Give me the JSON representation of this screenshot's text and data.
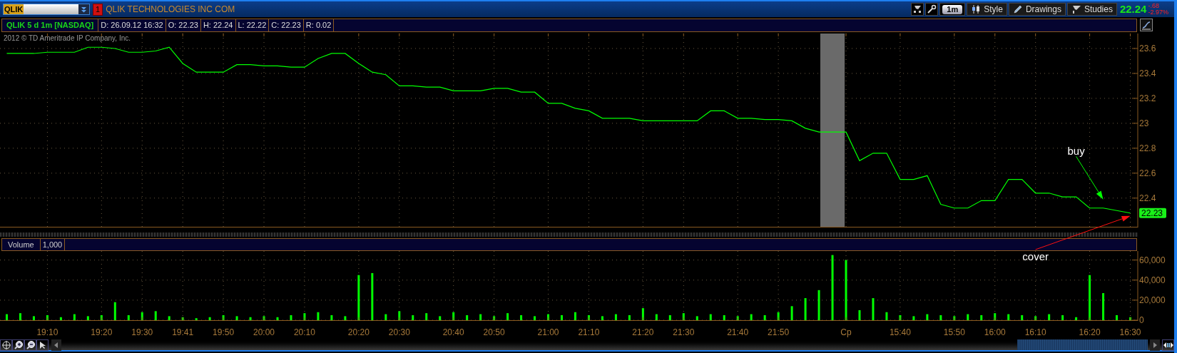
{
  "toolbar": {
    "symbol": "QLIK",
    "alert_count": "1",
    "company": "QLIK TECHNOLOGIES INC COM",
    "aggregation": "1m",
    "buttons": [
      "Style",
      "Drawings",
      "Studies"
    ],
    "last_price": "22.24",
    "change": "-.68",
    "change_percent": "-2.97%"
  },
  "info_bar": {
    "title": "QLIK 5 d 1m [NASDAQ]",
    "fields": [
      "D: 26.09.12 16:32",
      "O: 22.23",
      "H: 22.24",
      "L: 22.22",
      "C: 22.23",
      "R: 0.02"
    ]
  },
  "price_panel": {
    "copyright": "2012 © TD Ameritrade IP Company, Inc.",
    "last_price_label": "22.23",
    "chart_data": {
      "type": "line",
      "grid": true,
      "categories": [
        null,
        null,
        null,
        null,
        null,
        null,
        null,
        null,
        null,
        null,
        null,
        null,
        null,
        null,
        null,
        null,
        null,
        null,
        null,
        null,
        null,
        null,
        null,
        null,
        null,
        null,
        null,
        null,
        null,
        null,
        null,
        null,
        null,
        null,
        null,
        null,
        null,
        null,
        null,
        null,
        null,
        null,
        null,
        null,
        null,
        null,
        null,
        null,
        null,
        null,
        null,
        null,
        null,
        null,
        null,
        null,
        null,
        null,
        null,
        null,
        null,
        null,
        null,
        null,
        null,
        null,
        null,
        null,
        null,
        null,
        null,
        null,
        null,
        null,
        null,
        null,
        null,
        null,
        null,
        null,
        null,
        null,
        null,
        null
      ],
      "values": [
        23.56,
        23.56,
        23.56,
        23.57,
        23.57,
        23.57,
        23.61,
        23.61,
        23.6,
        23.57,
        23.57,
        23.58,
        23.61,
        23.48,
        23.41,
        23.41,
        23.41,
        23.47,
        23.47,
        23.46,
        23.46,
        23.45,
        23.45,
        23.52,
        23.56,
        23.56,
        23.48,
        23.41,
        23.39,
        23.3,
        23.3,
        23.29,
        23.29,
        23.26,
        23.26,
        23.26,
        23.28,
        23.28,
        23.25,
        23.25,
        23.16,
        23.16,
        23.12,
        23.1,
        23.04,
        23.04,
        23.04,
        23.02,
        23.02,
        23.02,
        23.02,
        23.02,
        23.1,
        23.1,
        23.04,
        23.04,
        23.03,
        23.03,
        23.02,
        22.96,
        22.93,
        22.93,
        22.93,
        22.7,
        22.76,
        22.76,
        22.55,
        22.55,
        22.58,
        22.35,
        22.32,
        22.32,
        22.38,
        22.38,
        22.55,
        22.55,
        22.44,
        22.44,
        22.41,
        22.41,
        22.32,
        22.32,
        22.3,
        22.28
      ],
      "ylim": [
        22.17,
        23.72
      ],
      "yticks": [
        22.4,
        22.6,
        22.8,
        23,
        23.2,
        23.4,
        23.6
      ],
      "annotations": [
        "buy",
        "cover"
      ]
    }
  },
  "volume_panel": {
    "header": [
      "Volume",
      "1,000"
    ],
    "chart_data": {
      "type": "bar",
      "grid": true,
      "categories": [
        null,
        null,
        null,
        "19:10",
        null,
        null,
        null,
        "19:20",
        null,
        null,
        "19:30",
        null,
        null,
        "19:41",
        null,
        null,
        "19:50",
        null,
        null,
        "20:00",
        null,
        null,
        "20:10",
        null,
        null,
        null,
        "20:20",
        null,
        null,
        "20:30",
        null,
        null,
        null,
        "20:40",
        null,
        null,
        "20:50",
        null,
        null,
        null,
        "21:00",
        null,
        null,
        "21:10",
        null,
        null,
        null,
        "21:20",
        null,
        null,
        "21:30",
        null,
        null,
        null,
        "21:40",
        null,
        null,
        "21:50",
        null,
        null,
        null,
        null,
        "Cp",
        null,
        null,
        null,
        "15:40",
        null,
        null,
        null,
        "15:50",
        null,
        null,
        "16:00",
        null,
        null,
        "16:10",
        null,
        null,
        null,
        "16:20",
        null,
        null,
        "16:30"
      ],
      "values": [
        6000,
        7000,
        4000,
        5000,
        3000,
        6000,
        4000,
        5000,
        18000,
        5000,
        8000,
        9000,
        4000,
        3000,
        2000,
        3000,
        5000,
        4000,
        3000,
        4000,
        3000,
        5000,
        7000,
        8000,
        5000,
        4000,
        45000,
        47000,
        6000,
        9000,
        5000,
        7000,
        4000,
        8000,
        5000,
        6000,
        4000,
        7000,
        5000,
        4000,
        6000,
        5000,
        8000,
        5000,
        4000,
        6000,
        5000,
        12000,
        6000,
        5000,
        7000,
        4000,
        6000,
        5000,
        4000,
        6000,
        5000,
        8000,
        14000,
        22000,
        30000,
        65000,
        60000,
        10000,
        22000,
        8000,
        5000,
        4000,
        6000,
        5000,
        4000,
        6000,
        5000,
        7000,
        6000,
        5000,
        4000,
        6000,
        5000,
        3000,
        45000,
        27000,
        5000,
        3000
      ],
      "ylim": [
        0,
        69000
      ],
      "yticks": [
        {
          "value": 0,
          "label": "0"
        },
        {
          "value": 20000,
          "label": "20,000"
        },
        {
          "value": 40000,
          "label": "40,000"
        },
        {
          "value": 60000,
          "label": "60,000"
        }
      ]
    }
  }
}
